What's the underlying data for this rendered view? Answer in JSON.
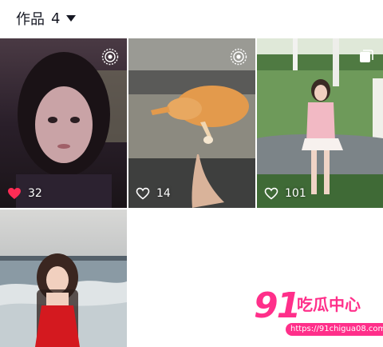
{
  "header": {
    "title": "作品",
    "count": "4"
  },
  "posts": [
    {
      "likes": "32",
      "liked": true,
      "badge": "live-photo-icon"
    },
    {
      "likes": "14",
      "liked": false,
      "badge": "live-photo-icon"
    },
    {
      "likes": "101",
      "liked": false,
      "badge": "multi-image-icon"
    },
    {
      "likes": "",
      "liked": false,
      "badge": ""
    }
  ],
  "watermark": {
    "number": "91",
    "name": "吃瓜中心",
    "url": "https://91chigua08.com"
  },
  "colors": {
    "like_active": "#fe2c55",
    "watermark": "#ff2f8a",
    "text": "#161823"
  }
}
